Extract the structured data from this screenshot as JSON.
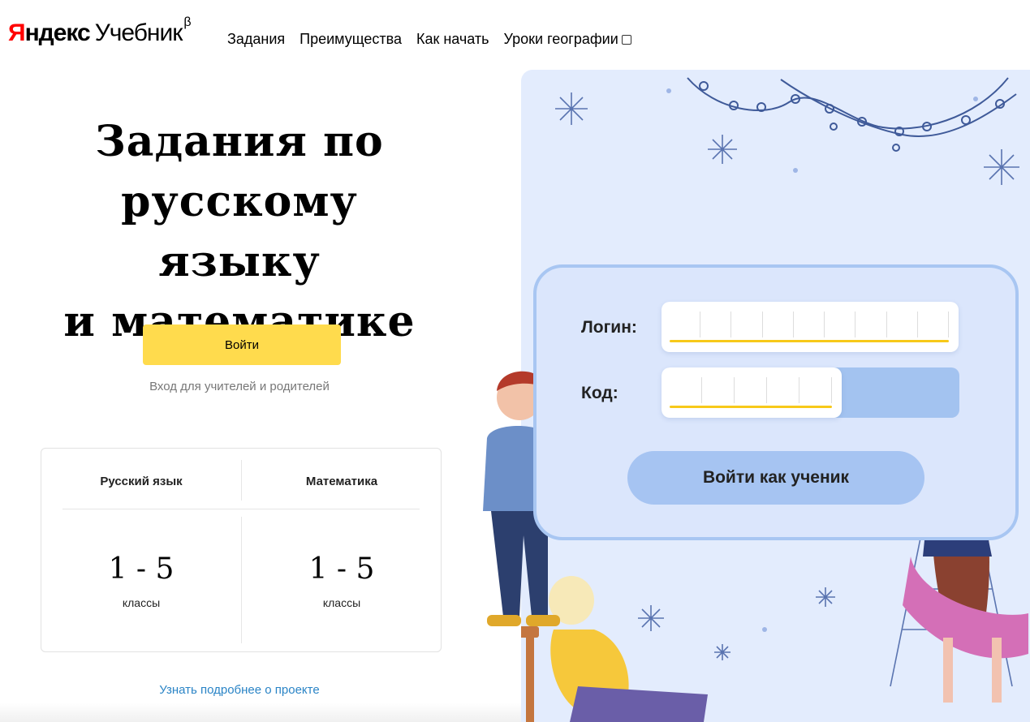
{
  "header": {
    "logo_ya": "Я",
    "logo_ndex": "ндекс",
    "logo_product": "Учебник",
    "logo_beta": "β",
    "nav": [
      {
        "label": "Задания"
      },
      {
        "label": "Преимущества"
      },
      {
        "label": "Как начать"
      },
      {
        "label": "Уроки географии",
        "external": true
      }
    ]
  },
  "hero": {
    "title_line1": "Задания по",
    "title_line2": "русскому языку",
    "title_line3": "и математике"
  },
  "teacher_login": {
    "button_label": "Войти",
    "subtitle": "Вход для учителей и родителей"
  },
  "grades": {
    "left": {
      "subject": "Русский язык",
      "range": "1 - 5",
      "unit": "классы"
    },
    "right": {
      "subject": "Математика",
      "range": "1 - 5",
      "unit": "классы"
    }
  },
  "more_link": "Узнать подробнее о проекте",
  "student_login": {
    "login_label": "Логин:",
    "code_label": "Код:",
    "button_label": "Войти как ученик",
    "login_cells": 9,
    "code_cells": 5,
    "code_fill_fraction": 0.6
  },
  "colors": {
    "accent_yellow": "#ffdb4d",
    "link_blue": "#2a84c6",
    "panel_blue": "#e3ecfd",
    "board_border": "#a8c6f2",
    "brand_red": "#ff0000"
  },
  "icons": {
    "external_link": "external-link-icon",
    "snowflake": "snowflake-icon",
    "garland": "garland-icon"
  }
}
